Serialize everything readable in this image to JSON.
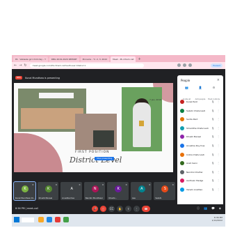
{
  "browser": {
    "tabs": [
      {
        "label": "Pk · Vakwale girl child day - Y"
      },
      {
        "label": "DBG 2019-2020 REPORT"
      },
      {
        "label": "Pinnacle - Yr. 2, 3, 2022"
      },
      {
        "label": "Meet - Pk-mtwm-nst",
        "active": true
      },
      {
        "label": "+"
      }
    ],
    "url": "meet.google.com/Pk-mtwm-nst?authuser=0&hs=1",
    "profile_label": "Paused"
  },
  "meet": {
    "rec_label": "REC",
    "presenting_text": "Kunal Mundhwa is presenting",
    "slide": {
      "date_text": "7 Jan, 2019",
      "heading_small": "FIRST POSITION",
      "heading_script": "District Level",
      "stop_button": "Stop presenting"
    },
    "people_panel": {
      "title": "People",
      "actions": [
        {
          "icon": "add-people-icon",
          "label": "Invite all"
        },
        {
          "icon": "person-add-icon",
          "label": "Add people"
        },
        {
          "icon": "host-controls-icon",
          "label": "Host controls"
        }
      ],
      "participants": [
        {
          "name": "Kunal Pant",
          "color": "#c5221f"
        },
        {
          "name": "Sakshi Chaturvedi",
          "color": "#0b8043"
        },
        {
          "name": "Sarita Pant",
          "color": "#e37400"
        },
        {
          "name": "Shraddha Chaturvedi Dua",
          "color": "#129eaf"
        },
        {
          "name": "Khushi Bansal",
          "color": "#8e24aa"
        },
        {
          "name": "Anushka Roy Dua",
          "color": "#1a73e8"
        },
        {
          "name": "Indira Chaturvedi",
          "color": "#e8710a"
        },
        {
          "name": "Ansh Saini",
          "color": "#33691e"
        },
        {
          "name": "Nandini Chuttar",
          "color": "#5f6368"
        },
        {
          "name": "Aadhvan Medge",
          "color": "#d81b60"
        },
        {
          "name": "Vanshi Anathan",
          "color": "#039be5"
        }
      ]
    },
    "tiles": [
      {
        "initial": "K",
        "name": "Kunal Mundhwa (Yo...",
        "color": "#7cb342",
        "selected": true
      },
      {
        "initial": "K",
        "name": "Khushil Bansal",
        "color": "#558b2f"
      },
      {
        "initial": "A",
        "name": "Anushka Dua",
        "color": "#3c4043"
      },
      {
        "initial": "N",
        "name": "Nandini Mundhwal",
        "color": "#ad1457"
      },
      {
        "initial": "K",
        "name": "Khushi...",
        "color": "#6a1b9a"
      },
      {
        "initial": "A",
        "name": "Aas",
        "color": "#00838f"
      },
      {
        "initial": "S",
        "name": "Sakshi",
        "color": "#e64a19"
      }
    ],
    "bottom": {
      "time_text": "8:36 PM | meet-call",
      "right_icons": [
        "info-icon",
        "people-icon",
        "chat-icon",
        "activities-icon"
      ]
    }
  },
  "taskbar": {
    "search_placeholder": "",
    "time": "8:36 PM",
    "date": "1/14/2022"
  }
}
